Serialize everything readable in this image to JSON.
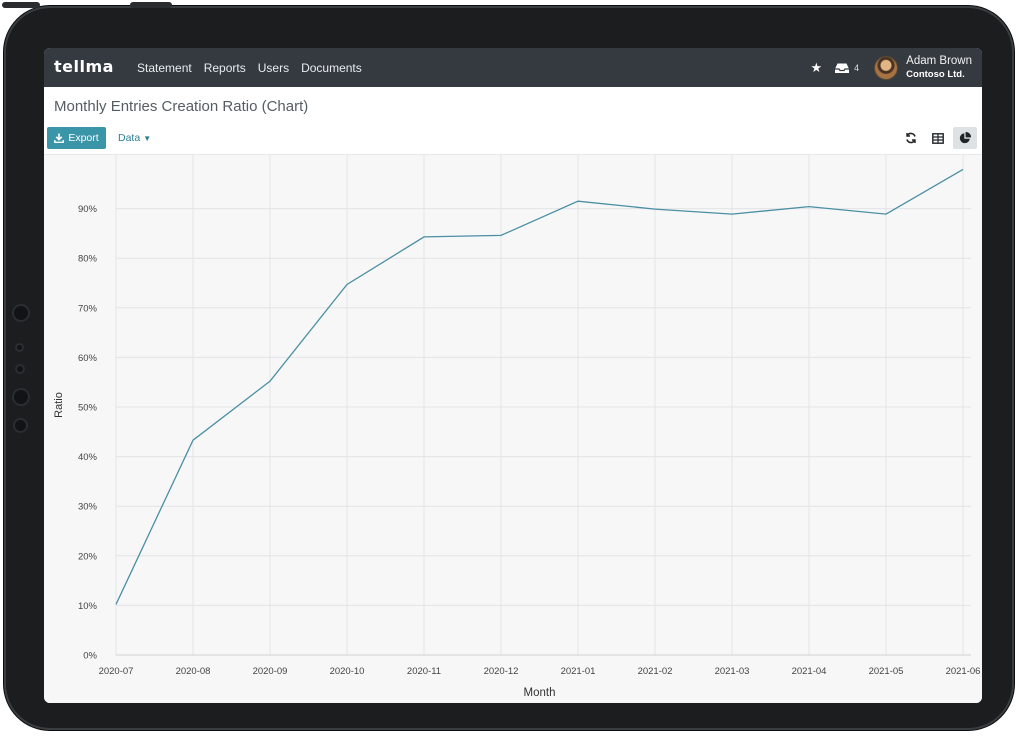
{
  "navbar": {
    "brand": "tellma",
    "links": [
      "Statement",
      "Reports",
      "Users",
      "Documents"
    ],
    "inbox_count": "4",
    "user_name": "Adam Brown",
    "company": "Contoso Ltd."
  },
  "page": {
    "title": "Monthly Entries Creation Ratio (Chart)"
  },
  "toolbar": {
    "export_label": "Export",
    "data_label": "Data"
  },
  "icons": {
    "brand": "logo-text",
    "star": "star-icon",
    "inbox": "inbox-icon",
    "export": "download-icon",
    "refresh": "refresh-icon",
    "table": "table-icon",
    "chart": "pie-chart-icon"
  },
  "colors": {
    "navbar": "#343a40",
    "accent": "#3a95a8",
    "line": "#4a8fa3"
  },
  "chart_data": {
    "type": "line",
    "xlabel": "Month",
    "ylabel": "Ratio",
    "ylim": [
      0,
      100
    ],
    "y_ticks": [
      "0%",
      "10%",
      "20%",
      "30%",
      "40%",
      "50%",
      "60%",
      "70%",
      "80%",
      "90%"
    ],
    "categories": [
      "2020-07",
      "2020-08",
      "2020-09",
      "2020-10",
      "2020-11",
      "2020-12",
      "2021-01",
      "2021-02",
      "2021-03",
      "2021-04",
      "2021-05",
      "2021-06"
    ],
    "series": [
      {
        "values": [
          10.2,
          43.3,
          55.2,
          74.7,
          84.3,
          84.6,
          91.5,
          89.9,
          88.9,
          90.4,
          88.9,
          97.9
        ]
      }
    ],
    "grid": true,
    "legend": "none"
  }
}
